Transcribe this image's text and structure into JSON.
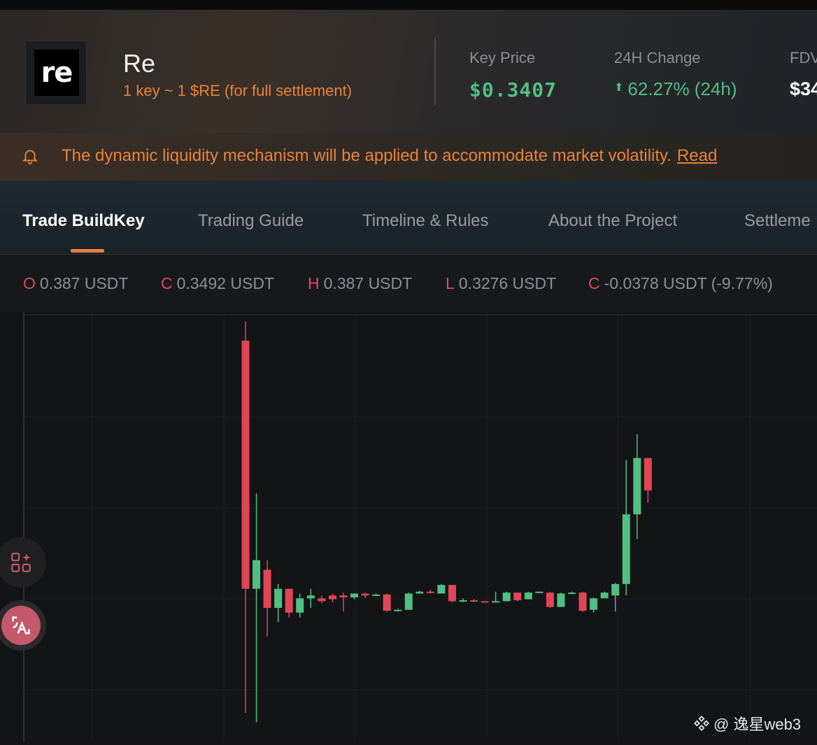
{
  "header": {
    "logo_text": "re",
    "name": "Re",
    "subtitle": "1 key ~ 1 $RE (for full settlement)",
    "stats": [
      {
        "label": "Key Price",
        "value": "$0.3407"
      },
      {
        "label": "24H Change",
        "value": "62.27% (24h)"
      },
      {
        "label": "FDV",
        "value": "$34"
      }
    ]
  },
  "notice": {
    "text": "The dynamic liquidity mechanism will be applied to accommodate market volatility.",
    "link": "Read"
  },
  "tabs": [
    {
      "label": "Trade BuildKey",
      "active": true
    },
    {
      "label": "Trading Guide",
      "active": false
    },
    {
      "label": "Timeline & Rules",
      "active": false
    },
    {
      "label": "About the Project",
      "active": false
    },
    {
      "label": "Settleme",
      "active": false
    }
  ],
  "ohlc": [
    {
      "key": "O",
      "value": "0.387 USDT"
    },
    {
      "key": "C",
      "value": "0.3492 USDT"
    },
    {
      "key": "H",
      "value": "0.387 USDT"
    },
    {
      "key": "L",
      "value": "0.3276 USDT"
    },
    {
      "key": "C",
      "value": "-0.0378 USDT (-9.77%)"
    }
  ],
  "colors": {
    "up": "#4fbf82",
    "down": "#e04656",
    "accent": "#e8823a"
  },
  "icons": [
    "bell-icon",
    "arrow-up-icon",
    "apps-sparkle-icon",
    "translate-icon",
    "binance-logo-icon"
  ],
  "watermark": "@ 逸星web3",
  "chart_data": {
    "type": "candlestick",
    "ylim": [
      0.18,
      0.63
    ],
    "candles": [
      {
        "o": 0.6,
        "h": 0.62,
        "l": 0.21,
        "c": 0.34
      },
      {
        "o": 0.34,
        "h": 0.44,
        "l": 0.2,
        "c": 0.37
      },
      {
        "o": 0.36,
        "h": 0.37,
        "l": 0.29,
        "c": 0.32
      },
      {
        "o": 0.32,
        "h": 0.345,
        "l": 0.305,
        "c": 0.34
      },
      {
        "o": 0.34,
        "h": 0.34,
        "l": 0.31,
        "c": 0.315
      },
      {
        "o": 0.315,
        "h": 0.335,
        "l": 0.31,
        "c": 0.33
      },
      {
        "o": 0.33,
        "h": 0.34,
        "l": 0.32,
        "c": 0.333
      },
      {
        "o": 0.33,
        "h": 0.333,
        "l": 0.325,
        "c": 0.327
      },
      {
        "o": 0.333,
        "h": 0.335,
        "l": 0.326,
        "c": 0.329
      },
      {
        "o": 0.333,
        "h": 0.336,
        "l": 0.316,
        "c": 0.331
      },
      {
        "o": 0.331,
        "h": 0.333,
        "l": 0.329,
        "c": 0.335
      },
      {
        "o": 0.335,
        "h": 0.336,
        "l": 0.33,
        "c": 0.333
      },
      {
        "o": 0.334,
        "h": 0.335,
        "l": 0.333,
        "c": 0.334
      },
      {
        "o": 0.334,
        "h": 0.335,
        "l": 0.316,
        "c": 0.317
      },
      {
        "o": 0.317,
        "h": 0.319,
        "l": 0.316,
        "c": 0.318
      },
      {
        "o": 0.318,
        "h": 0.336,
        "l": 0.318,
        "c": 0.335
      },
      {
        "o": 0.335,
        "h": 0.338,
        "l": 0.335,
        "c": 0.337
      },
      {
        "o": 0.337,
        "h": 0.339,
        "l": 0.335,
        "c": 0.336
      },
      {
        "o": 0.335,
        "h": 0.345,
        "l": 0.335,
        "c": 0.344
      },
      {
        "o": 0.344,
        "h": 0.344,
        "l": 0.326,
        "c": 0.327
      },
      {
        "o": 0.327,
        "h": 0.33,
        "l": 0.326,
        "c": 0.328
      },
      {
        "o": 0.328,
        "h": 0.329,
        "l": 0.326,
        "c": 0.327
      },
      {
        "o": 0.327,
        "h": 0.327,
        "l": 0.326,
        "c": 0.326
      },
      {
        "o": 0.326,
        "h": 0.337,
        "l": 0.326,
        "c": 0.327
      },
      {
        "o": 0.327,
        "h": 0.337,
        "l": 0.327,
        "c": 0.336
      },
      {
        "o": 0.336,
        "h": 0.336,
        "l": 0.327,
        "c": 0.328
      },
      {
        "o": 0.329,
        "h": 0.337,
        "l": 0.329,
        "c": 0.336
      },
      {
        "o": 0.336,
        "h": 0.337,
        "l": 0.336,
        "c": 0.337
      },
      {
        "o": 0.336,
        "h": 0.337,
        "l": 0.32,
        "c": 0.321
      },
      {
        "o": 0.321,
        "h": 0.336,
        "l": 0.321,
        "c": 0.335
      },
      {
        "o": 0.336,
        "h": 0.337,
        "l": 0.335,
        "c": 0.336
      },
      {
        "o": 0.336,
        "h": 0.337,
        "l": 0.316,
        "c": 0.317
      },
      {
        "o": 0.318,
        "h": 0.331,
        "l": 0.315,
        "c": 0.33
      },
      {
        "o": 0.33,
        "h": 0.337,
        "l": 0.33,
        "c": 0.336
      },
      {
        "o": 0.333,
        "h": 0.346,
        "l": 0.316,
        "c": 0.345
      },
      {
        "o": 0.345,
        "h": 0.475,
        "l": 0.333,
        "c": 0.418
      },
      {
        "o": 0.418,
        "h": 0.502,
        "l": 0.392,
        "c": 0.477
      },
      {
        "o": 0.477,
        "h": 0.477,
        "l": 0.43,
        "c": 0.443
      }
    ]
  }
}
